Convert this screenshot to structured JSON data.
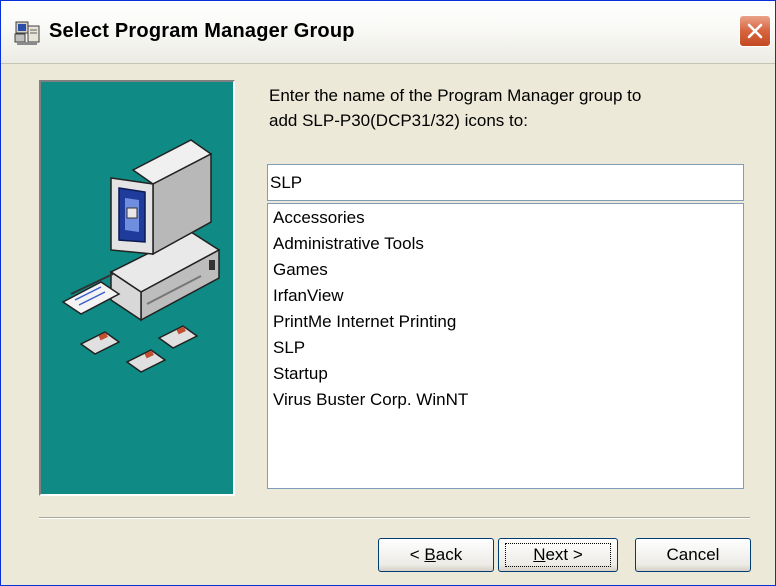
{
  "window": {
    "title": "Select Program Manager Group",
    "icon": "setup-computer-icon",
    "close_icon": "close-x-icon"
  },
  "prompt": {
    "line1": "Enter the name of the Program Manager group to",
    "line2": "add SLP-P30(DCP31/32) icons to:"
  },
  "group_input": {
    "value": "SLP"
  },
  "group_list": {
    "items": [
      "Accessories",
      "Administrative Tools",
      "Games",
      "IrfanView",
      "PrintMe Internet Printing",
      "SLP",
      "Startup",
      "Virus Buster Corp. WinNT"
    ]
  },
  "buttons": {
    "back": {
      "prefix": "< ",
      "mnemonic": "B",
      "rest": "ack"
    },
    "next": {
      "mnemonic": "N",
      "rest": "ext >"
    },
    "cancel": {
      "label": "Cancel"
    }
  },
  "colors": {
    "title_bar": "#f6f5f0",
    "close_button": "#d8643f",
    "art_background": "#0f8a84",
    "dialog_background": "#ece9d8"
  }
}
